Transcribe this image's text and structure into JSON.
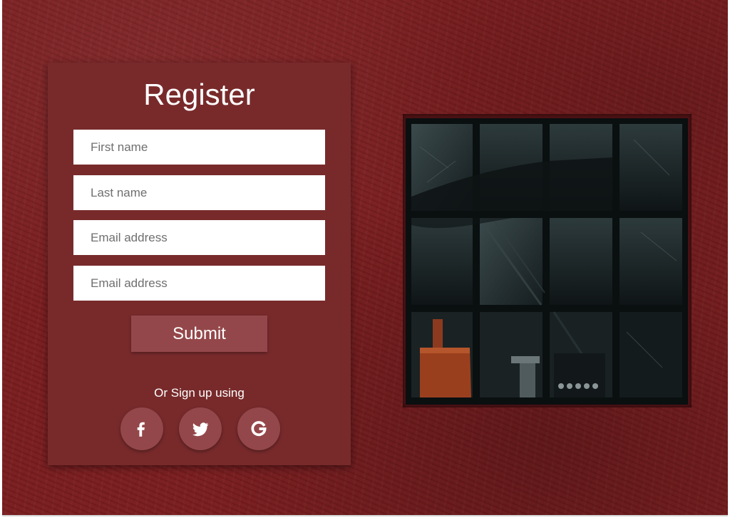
{
  "form": {
    "title": "Register",
    "fields": [
      {
        "placeholder": "First name"
      },
      {
        "placeholder": "Last name"
      },
      {
        "placeholder": "Email address"
      },
      {
        "placeholder": "Email address"
      }
    ],
    "submit_label": "Submit",
    "social_label": "Or Sign up using",
    "social_buttons": [
      {
        "icon": "facebook-icon"
      },
      {
        "icon": "twitter-icon"
      },
      {
        "icon": "google-icon"
      }
    ]
  },
  "colors": {
    "wall": "#7a1d1f",
    "card": "#782a2b",
    "button": "#94474a",
    "text": "#ffffff"
  }
}
